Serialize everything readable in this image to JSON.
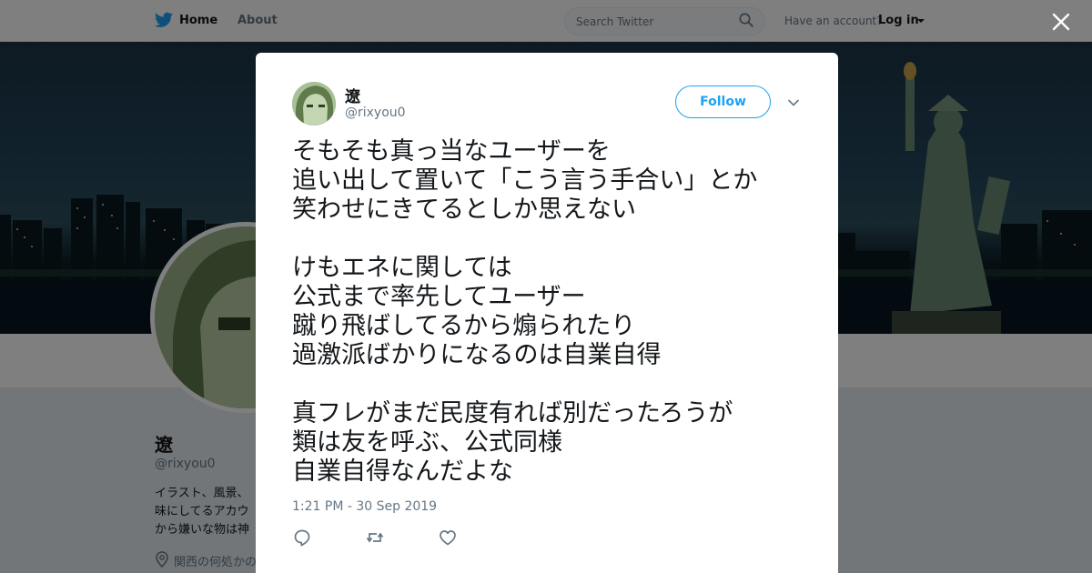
{
  "topbar": {
    "home_label": "Home",
    "about_label": "About",
    "search_placeholder": "Search Twitter",
    "have_account": "Have an account?",
    "login_label": "Log in"
  },
  "profile": {
    "name": "遼",
    "handle": "@rixyou0",
    "bio_lines": [
      "イラスト、風景、",
      "味にしてるアカウ",
      "から嫌いな物は神"
    ],
    "location": "関西の何処かの"
  },
  "tweet": {
    "author_name": "遼",
    "author_handle": "@rixyou0",
    "follow_label": "Follow",
    "lines": [
      "そもそも真っ当なユーザーを",
      "追い出して置いて「こう言う手合い」とか",
      "笑わせにきてるとしか思えない",
      "",
      "けもエネに関しては",
      "公式まで率先してユーザー",
      "蹴り飛ばしてるから煽られたり",
      "過激派ばかりになるのは自業自得",
      "",
      "真フレがまだ民度有れば別だったろうが",
      "類は友を呼ぶ、公式同様",
      "自業自得なんだよな"
    ],
    "timestamp": "1:21 PM - 30 Sep 2019"
  },
  "icons": {
    "logo": "twitter-bird-icon",
    "search": "search-icon",
    "close": "close-icon",
    "more": "chevron-down-icon",
    "reply": "reply-icon",
    "retweet": "retweet-icon",
    "like": "heart-icon",
    "location": "location-pin-icon"
  },
  "colors": {
    "brand_blue": "#1da1f2",
    "text_primary": "#14171a",
    "text_secondary": "#657786"
  }
}
